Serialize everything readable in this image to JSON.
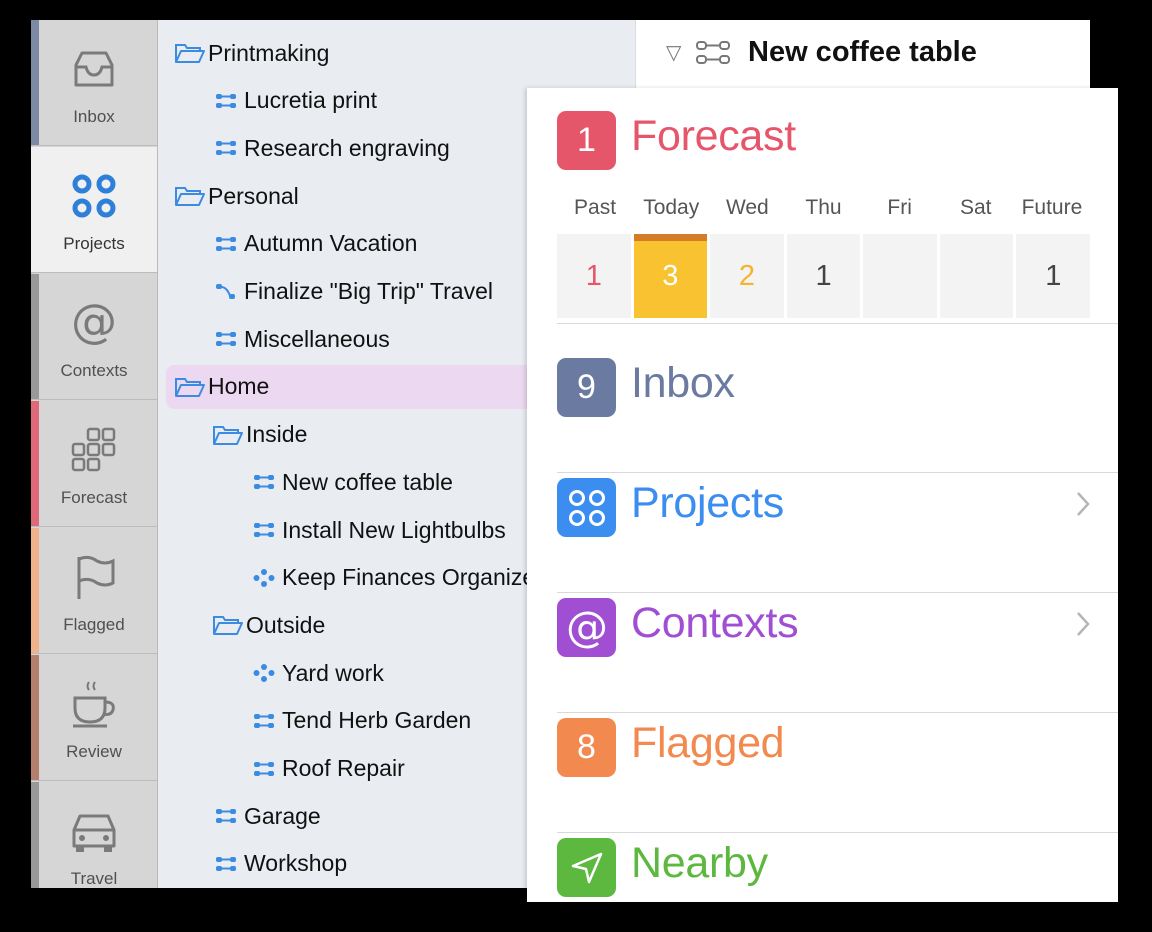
{
  "perspectives": [
    {
      "label": "Inbox",
      "icon": "inbox-icon",
      "color": "#7e8aa5"
    },
    {
      "label": "Projects",
      "icon": "projects-icon",
      "color": "#3e86d8",
      "active": true
    },
    {
      "label": "Contexts",
      "icon": "at-sign-icon",
      "color": "#999999"
    },
    {
      "label": "Forecast",
      "icon": "forecast-grid-icon",
      "color": "#de6a79"
    },
    {
      "label": "Flagged",
      "icon": "flag-icon",
      "color": "#efb28a"
    },
    {
      "label": "Review",
      "icon": "coffee-cup-icon",
      "color": "#b47f6c"
    },
    {
      "label": "Travel",
      "icon": "car-icon",
      "color": "#999999"
    }
  ],
  "outline": [
    {
      "label": "Printmaking",
      "type": "folder",
      "indent": 0
    },
    {
      "label": "Lucretia print",
      "type": "parallel-project",
      "indent": 1
    },
    {
      "label": "Research engraving",
      "type": "parallel-project",
      "indent": 1
    },
    {
      "label": "Personal",
      "type": "folder",
      "indent": 0
    },
    {
      "label": "Autumn Vacation",
      "type": "parallel-project",
      "indent": 1
    },
    {
      "label": "Finalize \"Big Trip\" Travel",
      "type": "sequential-project",
      "indent": 1
    },
    {
      "label": "Miscellaneous",
      "type": "parallel-project",
      "indent": 1
    },
    {
      "label": "Home",
      "type": "folder",
      "indent": 0,
      "selected": true
    },
    {
      "label": "Inside",
      "type": "folder",
      "indent": 1
    },
    {
      "label": "New coffee table",
      "type": "parallel-project",
      "indent": 2
    },
    {
      "label": "Install New Lightbulbs",
      "type": "parallel-project",
      "indent": 2
    },
    {
      "label": "Keep Finances Organized",
      "type": "single-action-list",
      "indent": 2
    },
    {
      "label": "Outside",
      "type": "folder",
      "indent": 1
    },
    {
      "label": "Yard work",
      "type": "single-action-list",
      "indent": 2
    },
    {
      "label": "Tend Herb Garden",
      "type": "parallel-project",
      "indent": 2
    },
    {
      "label": "Roof Repair",
      "type": "parallel-project",
      "indent": 2
    },
    {
      "label": "Garage",
      "type": "parallel-project",
      "indent": 1
    },
    {
      "label": "Workshop",
      "type": "parallel-project",
      "indent": 1
    }
  ],
  "detail": {
    "disclosure": "▽",
    "title": "New coffee table"
  },
  "ios": {
    "forecast": {
      "badge": "1",
      "label": "Forecast",
      "color": "#e5566b",
      "days": [
        "Past",
        "Today",
        "Wed",
        "Thu",
        "Fri",
        "Sat",
        "Future"
      ],
      "counts": [
        "1",
        "3",
        "2",
        "1",
        "",
        "",
        "1"
      ],
      "count_colors": [
        "#e5566b",
        "#ffffff",
        "#f5b429",
        "#444444",
        "#444444",
        "#444444",
        "#444444"
      ]
    },
    "rows": [
      {
        "badge": "9",
        "label": "Inbox",
        "color": "#6b7aa0",
        "chevron": false,
        "icon": "inbox"
      },
      {
        "badge": "",
        "label": "Projects",
        "color": "#3b8ef0",
        "chevron": true,
        "icon": "projects-icon"
      },
      {
        "badge": "",
        "label": "Contexts",
        "color": "#a14fd2",
        "chevron": true,
        "icon": "at-sign-icon"
      },
      {
        "badge": "8",
        "label": "Flagged",
        "color": "#f2894f",
        "chevron": false,
        "icon": "flagged"
      },
      {
        "badge": "",
        "label": "Nearby",
        "color": "#5db840",
        "chevron": false,
        "icon": "location-arrow-icon"
      }
    ]
  }
}
